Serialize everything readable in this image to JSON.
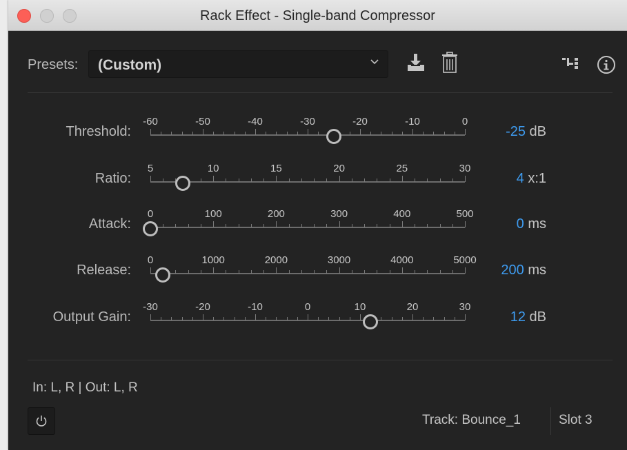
{
  "window": {
    "title": "Rack Effect - Single-band Compressor"
  },
  "presets": {
    "label": "Presets:",
    "value": "(Custom)"
  },
  "icons": {
    "chevron": "chevron-down-icon",
    "save": "save-preset-icon",
    "delete": "trash-icon",
    "routing": "channel-routing-icon",
    "info": "info-icon",
    "power": "power-icon"
  },
  "params": [
    {
      "name": "threshold",
      "label": "Threshold:",
      "ticks": [
        "-60",
        "-50",
        "-40",
        "-30",
        "-20",
        "-10",
        "0"
      ],
      "min": -60,
      "max": 0,
      "value": -25,
      "value_text": "-25",
      "unit": "dB"
    },
    {
      "name": "ratio",
      "label": "Ratio:",
      "ticks": [
        "5",
        "10",
        "15",
        "20",
        "25",
        "30"
      ],
      "min": 1,
      "max": 30,
      "value": 4,
      "value_text": "4",
      "unit": "x:1"
    },
    {
      "name": "attack",
      "label": "Attack:",
      "ticks": [
        "0",
        "100",
        "200",
        "300",
        "400",
        "500"
      ],
      "min": 0,
      "max": 500,
      "value": 0,
      "value_text": "0",
      "unit": "ms"
    },
    {
      "name": "release",
      "label": "Release:",
      "ticks": [
        "0",
        "1000",
        "2000",
        "3000",
        "4000",
        "5000"
      ],
      "min": 0,
      "max": 5000,
      "value": 200,
      "value_text": "200",
      "unit": "ms"
    },
    {
      "name": "output-gain",
      "label": "Output Gain:",
      "ticks": [
        "-30",
        "-20",
        "-10",
        "0",
        "10",
        "20",
        "30"
      ],
      "min": -30,
      "max": 30,
      "value": 12,
      "value_text": "12",
      "unit": "dB"
    }
  ],
  "footer": {
    "io": "In: L, R | Out: L, R",
    "track": "Track: Bounce_1",
    "slot": "Slot 3"
  },
  "colors": {
    "value_accent": "#3e9bef",
    "close_button": "#fc5f57"
  }
}
